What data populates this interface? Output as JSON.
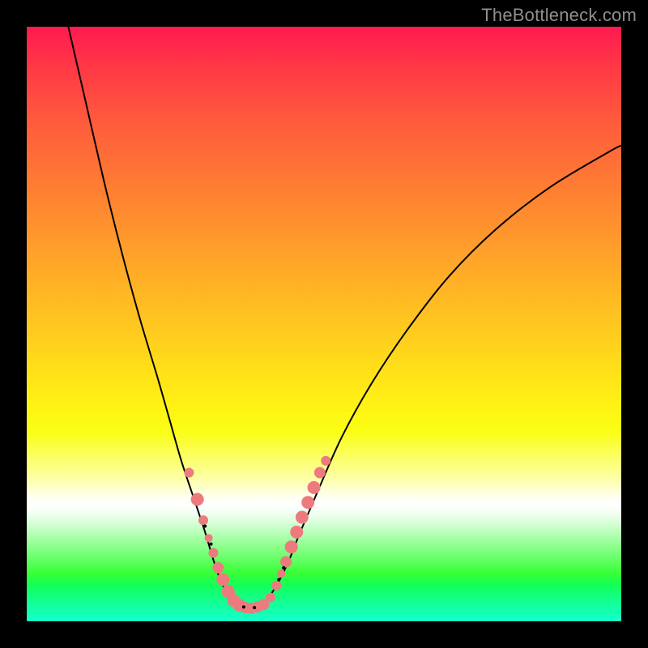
{
  "watermark": "TheBottleneck.com",
  "chart_data": {
    "type": "line",
    "title": "",
    "xlabel": "",
    "ylabel": "",
    "xlim": [
      0,
      100
    ],
    "ylim": [
      0,
      100
    ],
    "grid": false,
    "legend": false,
    "series": [
      {
        "name": "bottleneck-curve-left",
        "color": "#000000",
        "x": [
          7,
          10,
          13,
          16,
          19,
          22,
          24,
          26,
          28,
          30,
          31.5,
          33,
          35
        ],
        "y": [
          100,
          87,
          74,
          62,
          51,
          41,
          34,
          27,
          21,
          15,
          10,
          6,
          3
        ]
      },
      {
        "name": "bottleneck-curve-right",
        "color": "#000000",
        "x": [
          40,
          42,
          44,
          46,
          49,
          53,
          58,
          64,
          71,
          79,
          88,
          98,
          100
        ],
        "y": [
          3,
          6,
          10,
          15,
          22,
          31,
          40,
          49,
          58,
          66,
          73,
          79,
          80
        ]
      },
      {
        "name": "valley-floor",
        "color": "#000000",
        "x": [
          35,
          36,
          37,
          38,
          39,
          40
        ],
        "y": [
          3,
          2.5,
          2.3,
          2.3,
          2.5,
          3
        ]
      }
    ],
    "markers": [
      {
        "name": "marker-dots-left",
        "color": "#ed7b7e",
        "points": [
          {
            "x": 27.3,
            "y": 25.0,
            "r": 6
          },
          {
            "x": 28.7,
            "y": 20.5,
            "r": 8
          },
          {
            "x": 29.7,
            "y": 17.0,
            "r": 6
          },
          {
            "x": 30.6,
            "y": 14.0,
            "r": 5
          },
          {
            "x": 31.4,
            "y": 11.5,
            "r": 6
          },
          {
            "x": 32.2,
            "y": 9.0,
            "r": 7
          },
          {
            "x": 33.0,
            "y": 7.0,
            "r": 8
          },
          {
            "x": 33.9,
            "y": 5.0,
            "r": 8
          },
          {
            "x": 34.8,
            "y": 3.5,
            "r": 8
          },
          {
            "x": 35.8,
            "y": 2.7,
            "r": 8
          },
          {
            "x": 36.8,
            "y": 2.3,
            "r": 7
          },
          {
            "x": 37.8,
            "y": 2.2,
            "r": 7
          },
          {
            "x": 38.8,
            "y": 2.4,
            "r": 7
          },
          {
            "x": 39.8,
            "y": 2.8,
            "r": 7
          }
        ]
      },
      {
        "name": "marker-dots-right",
        "color": "#ed7b7e",
        "points": [
          {
            "x": 41.0,
            "y": 4.0,
            "r": 6
          },
          {
            "x": 42.0,
            "y": 6.0,
            "r": 6
          },
          {
            "x": 42.8,
            "y": 8.0,
            "r": 5
          },
          {
            "x": 43.6,
            "y": 10.0,
            "r": 7
          },
          {
            "x": 44.5,
            "y": 12.5,
            "r": 8
          },
          {
            "x": 45.4,
            "y": 15.0,
            "r": 8
          },
          {
            "x": 46.3,
            "y": 17.5,
            "r": 8
          },
          {
            "x": 47.3,
            "y": 20.0,
            "r": 8
          },
          {
            "x": 48.3,
            "y": 22.5,
            "r": 8
          },
          {
            "x": 49.3,
            "y": 25.0,
            "r": 7
          },
          {
            "x": 50.3,
            "y": 27.0,
            "r": 6
          }
        ]
      },
      {
        "name": "marker-small-black",
        "color": "#000000",
        "points": [
          {
            "x": 30.0,
            "y": 16.0,
            "r": 2
          },
          {
            "x": 31.0,
            "y": 13.0,
            "r": 2
          },
          {
            "x": 36.5,
            "y": 2.4,
            "r": 2
          },
          {
            "x": 38.3,
            "y": 2.3,
            "r": 2
          },
          {
            "x": 42.4,
            "y": 7.0,
            "r": 2
          },
          {
            "x": 43.2,
            "y": 9.0,
            "r": 2
          }
        ]
      }
    ]
  }
}
